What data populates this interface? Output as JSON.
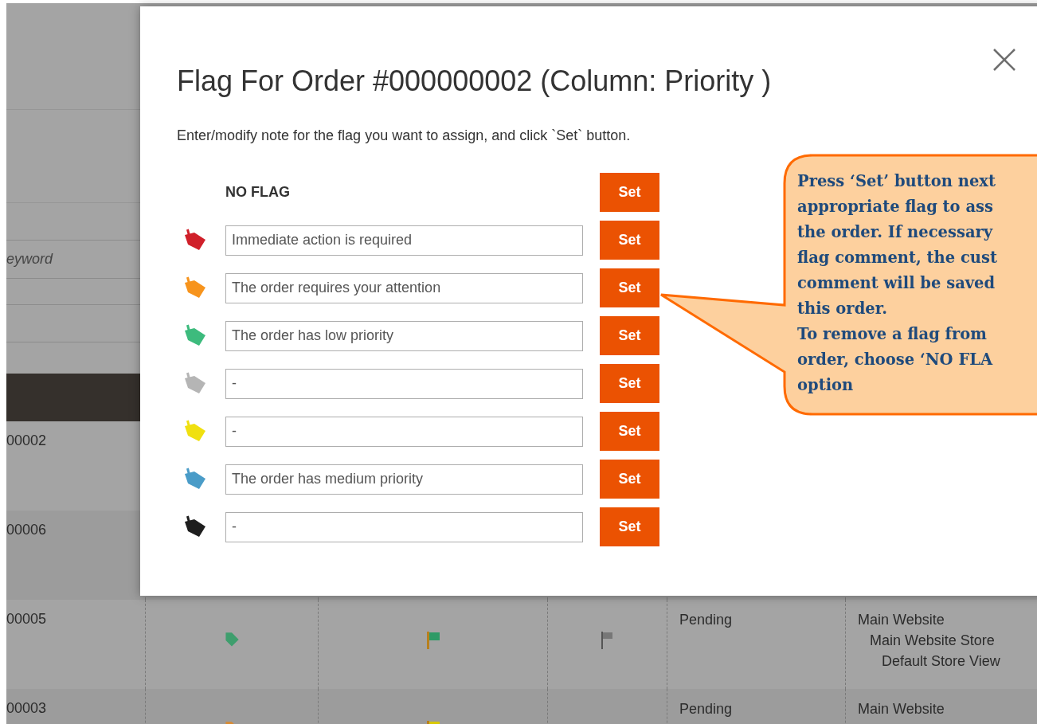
{
  "background": {
    "filter_placeholder": "eyword",
    "rows": [
      {
        "order": "00002"
      },
      {
        "order": "00006"
      },
      {
        "order": "00005",
        "tag": {
          "color": "#3e9e6d"
        },
        "flag": {
          "color": "#2e9a66"
        },
        "status": "Pending",
        "store": [
          "Main Website",
          "Main Website Store",
          "Default Store View"
        ]
      },
      {
        "order": "00003",
        "tag": {
          "color": "#d88a30"
        },
        "flag": {
          "color": "#d8c800"
        },
        "status": "Pending",
        "store": [
          "Main Website"
        ]
      }
    ]
  },
  "modal": {
    "title": "Flag For Order #000000002 (Column: Priority )",
    "instruction": "Enter/modify note for the flag you want to assign, and click `Set` button."
  },
  "flags": [
    {
      "kind": "none",
      "label": "NO FLAG",
      "button": "Set"
    },
    {
      "kind": "flag",
      "color": "#d0202a",
      "note": "Immediate action is required",
      "button": "Set"
    },
    {
      "kind": "flag",
      "color": "#f7941d",
      "note": "The order requires your attention",
      "button": "Set"
    },
    {
      "kind": "flag",
      "color": "#3dbb7d",
      "note": "The order has low priority",
      "button": "Set"
    },
    {
      "kind": "flag",
      "color": "#b5b5b5",
      "note": "-",
      "button": "Set"
    },
    {
      "kind": "flag",
      "color": "#f0e010",
      "note": "-",
      "button": "Set"
    },
    {
      "kind": "flag",
      "color": "#4a9cc8",
      "note": "The order has medium priority",
      "button": "Set"
    },
    {
      "kind": "flag",
      "color": "#1e1e1e",
      "note": "-",
      "button": "Set"
    }
  ],
  "callout": {
    "paragraphs": [
      "Press ‘Set’ button next\nappropriate flag to ass\nthe order. If necessary\nflag comment, the cust\ncomment will be saved\nthis order.",
      "To remove a flag from\norder, choose ‘NO FLA\noption"
    ]
  }
}
